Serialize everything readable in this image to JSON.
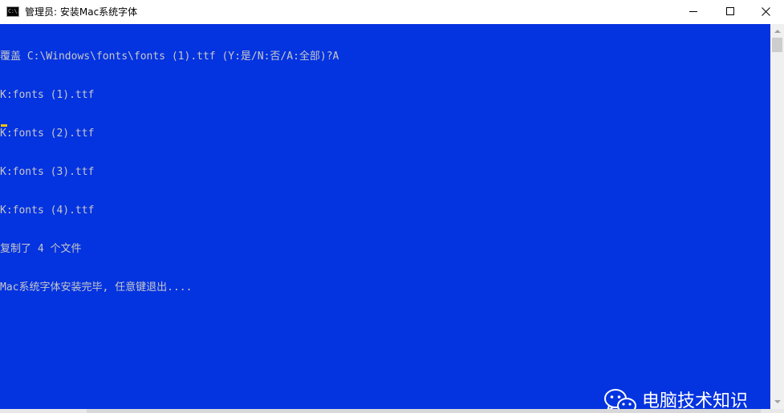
{
  "window": {
    "title": "管理员: 安装Mac系统字体",
    "icon": "cmd-icon",
    "icon_glyph": "C:\\.",
    "controls": {
      "minimize": "minimize-icon",
      "maximize": "maximize-icon",
      "close": "close-icon"
    }
  },
  "console": {
    "background_color": "#0433e0",
    "text_color": "#c8c8c8",
    "cursor_color": "#f5c400",
    "lines": [
      "覆盖 C:\\Windows\\fonts\\fonts (1).ttf (Y:是/N:否/A:全部)?A",
      "K:fonts (1).ttf",
      "K:fonts (2).ttf",
      "K:fonts (3).ttf",
      "K:fonts (4).ttf",
      "复制了 4 个文件",
      "Mac系统字体安装完毕, 任意键退出...."
    ]
  },
  "watermark": {
    "icon": "wechat-icon",
    "text": "电脑技术知识"
  }
}
